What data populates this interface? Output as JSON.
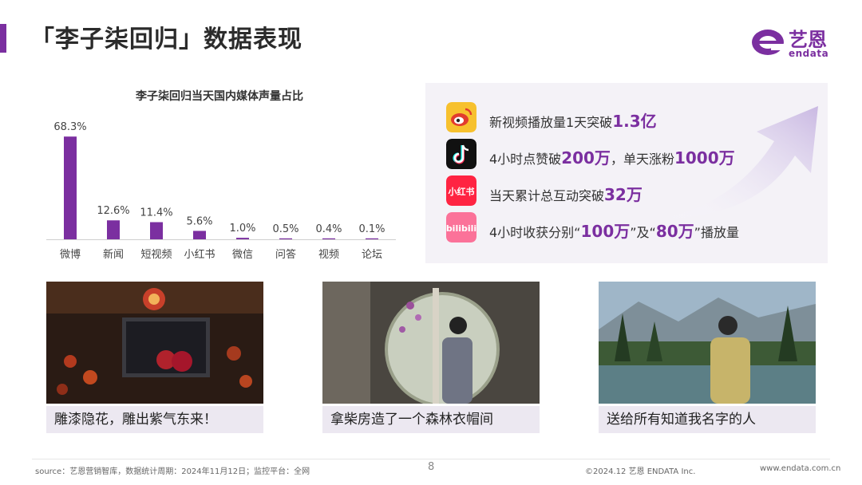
{
  "page": {
    "title": "「李子柒回归」数据表现",
    "accent": "#7b2fa0"
  },
  "logo": {
    "name": "艺恩",
    "sub": "endata"
  },
  "chart_data": {
    "type": "bar",
    "title": "李子柒回归当天国内媒体声量占比",
    "categories": [
      "微博",
      "新闻",
      "短视频",
      "小红书",
      "微信",
      "问答",
      "视频",
      "论坛"
    ],
    "values": [
      68.3,
      12.6,
      11.4,
      5.6,
      1.0,
      0.5,
      0.4,
      0.1
    ],
    "value_labels": [
      "68.3%",
      "12.6%",
      "11.4%",
      "5.6%",
      "1.0%",
      "0.5%",
      "0.4%",
      "0.1%"
    ],
    "unit": "%",
    "ylim": [
      0,
      70
    ],
    "color": "#7b2fa0",
    "grid": false,
    "xlabel": "",
    "ylabel": ""
  },
  "stats": [
    {
      "icon": "weibo-icon",
      "pre": "新视频播放量1天突破",
      "hl1": "1.3亿",
      "mid": "",
      "hl2": "",
      "post": ""
    },
    {
      "icon": "douyin-icon",
      "pre": "4小时点赞破",
      "hl1": "200万",
      "mid": "，单天涨粉",
      "hl2": "1000万",
      "post": ""
    },
    {
      "icon": "xiaohongshu-icon",
      "pre": "当天累计总互动突破",
      "hl1": "32万",
      "mid": "",
      "hl2": "",
      "post": ""
    },
    {
      "icon": "bilibili-icon",
      "pre": "4小时收获分别“",
      "hl1": "100万",
      "mid": "”及“",
      "hl2": "80万",
      "post": "”播放量"
    }
  ],
  "cards": [
    {
      "caption": "雕漆隐花，雕出紫气东来！"
    },
    {
      "caption": "拿柴房造了一个森林衣帽间"
    },
    {
      "caption": "送给所有知道我名字的人"
    }
  ],
  "footer": {
    "source": "source：艺恩营销智库，数据统计周期：2024年11月12日；监控平台：全网",
    "page": "8",
    "copyright": "©2024.12 艺恩 ENDATA Inc.",
    "url": "www.endata.com.cn"
  }
}
